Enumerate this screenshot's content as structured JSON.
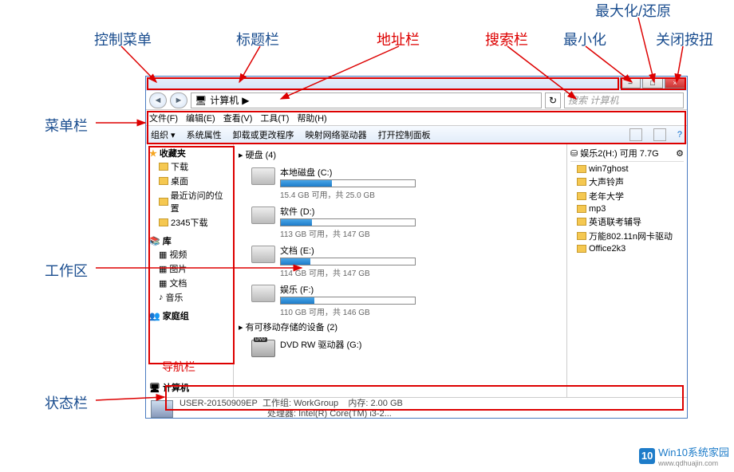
{
  "annotations": {
    "control_menu": "控制菜单",
    "title_bar": "标题栏",
    "address_bar": "地址栏",
    "search_bar": "搜索栏",
    "minimize": "最小化",
    "max_restore": "最大化/还原",
    "close_btn": "关闭按扭",
    "menu_bar": "菜单栏",
    "work_area": "工作区",
    "status_bar": "状态栏",
    "nav_caption": "导航栏"
  },
  "address": {
    "icon_label": "计算机",
    "crumb": "计算机",
    "sep": "▶"
  },
  "search": {
    "placeholder": "搜索 计算机"
  },
  "menubar": {
    "file": "文件(F)",
    "edit": "编辑(E)",
    "view": "查看(V)",
    "tools": "工具(T)",
    "help": "帮助(H)"
  },
  "cmdbar": {
    "organize": "组织 ▾",
    "sysprops": "系统属性",
    "uninstall": "卸载或更改程序",
    "mapnet": "映射网络驱动器",
    "ctrlpanel": "打开控制面板"
  },
  "nav": {
    "favorites": {
      "hdr": "收藏夹",
      "items": [
        "下载",
        "桌面",
        "最近访问的位置",
        "2345下载"
      ]
    },
    "libraries": {
      "hdr": "库",
      "items": [
        "视频",
        "图片",
        "文档",
        "音乐"
      ]
    },
    "homegroup": "家庭组",
    "computer": "计算机"
  },
  "main": {
    "drives_hdr": "▸ 硬盘 (4)",
    "drives": [
      {
        "name": "本地磁盘 (C:)",
        "free": "15.4 GB 可用，共 25.0 GB",
        "pct": 38
      },
      {
        "name": "软件 (D:)",
        "free": "113 GB 可用，共 147 GB",
        "pct": 23
      },
      {
        "name": "文档 (E:)",
        "free": "114 GB 可用，共 147 GB",
        "pct": 22
      },
      {
        "name": "娱乐 (F:)",
        "free": "110 GB 可用，共 146 GB",
        "pct": 25
      }
    ],
    "removable_hdr": "▸ 有可移动存储的设备 (2)",
    "dvd": "DVD RW 驱动器 (G:)"
  },
  "rightpane": {
    "hdr": "娱乐2(H:) 可用 7.7G",
    "items": [
      "win7ghost",
      "大声铃声",
      "老年大学",
      "mp3",
      "英语联考辅导",
      "万能802.11n网卡驱动",
      "Office2k3"
    ]
  },
  "status": {
    "name": "USER-20150909EP",
    "wg_label": "工作组:",
    "wg": "WorkGroup",
    "mem_label": "内存:",
    "mem": "2.00 GB",
    "cpu_label": "处理器:",
    "cpu": "Intel(R) Core(TM) i3-2..."
  },
  "watermark": {
    "logo": "10",
    "line1": "Win10系统家园",
    "line2": "www.qdhuajin.com"
  }
}
